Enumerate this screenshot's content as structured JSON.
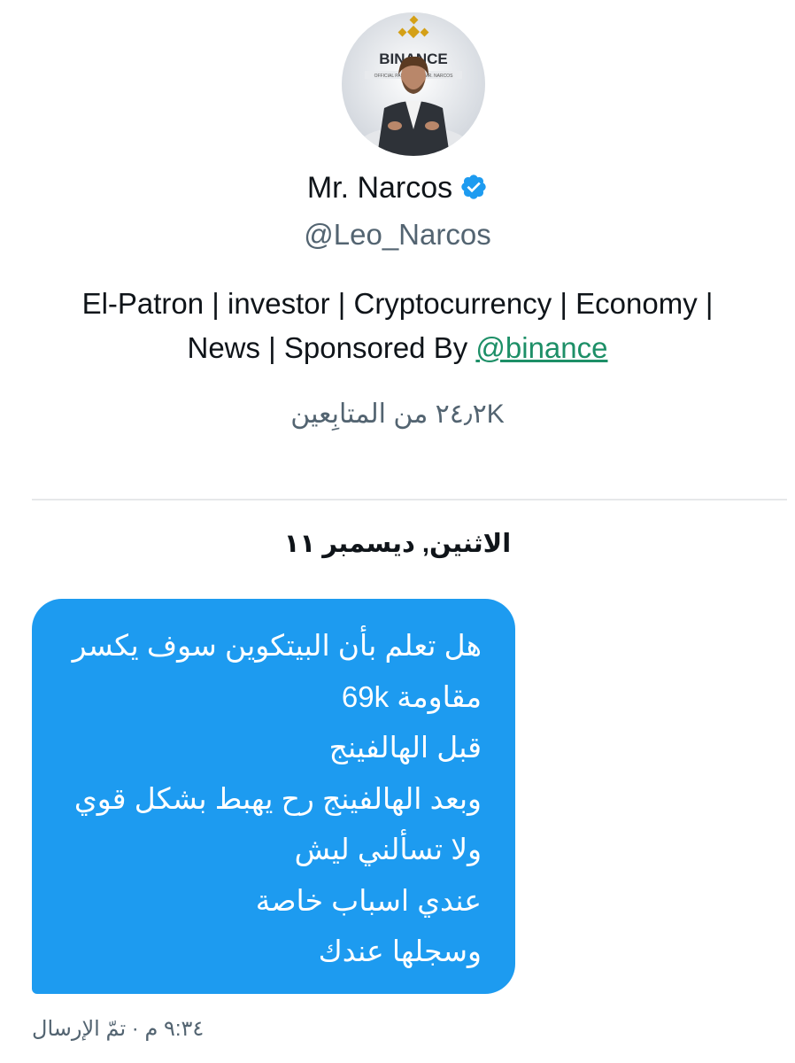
{
  "profile": {
    "display_name": "Mr. Narcos",
    "handle": "@Leo_Narcos",
    "bio_text": "El-Patron | investor | Cryptocurrency | Economy | News | Sponsored By",
    "bio_mention": "@binance",
    "followers_text": "٢٤٫٢K من المتابِعين",
    "avatar": {
      "brand_text": "BINANCE",
      "banner_text": "OFFICIAL PARTNER OF MR. NARCOS"
    }
  },
  "conversation": {
    "date_separator": "الاثنين, ديسمبر ١١",
    "message": {
      "lines": [
        "هل تعلم بأن البيتكوين سوف يكسر",
        "مقاومة 69k",
        "قبل الهالفينج",
        "وبعد الهالفينج رح يهبط بشكل قوي",
        "ولا تسألني ليش",
        "عندي اسباب خاصة",
        "وسجلها عندك"
      ],
      "meta": "٩:٣٤ م · تمّ الإرسال"
    }
  },
  "colors": {
    "bubble": "#1d9bf0",
    "verified": "#1d9bf0",
    "mention": "#1d8f67",
    "secondary_text": "#536471",
    "divider": "#e6e8ea"
  },
  "icons": {
    "verified": "verified-badge-icon",
    "avatar": "profile-avatar"
  }
}
